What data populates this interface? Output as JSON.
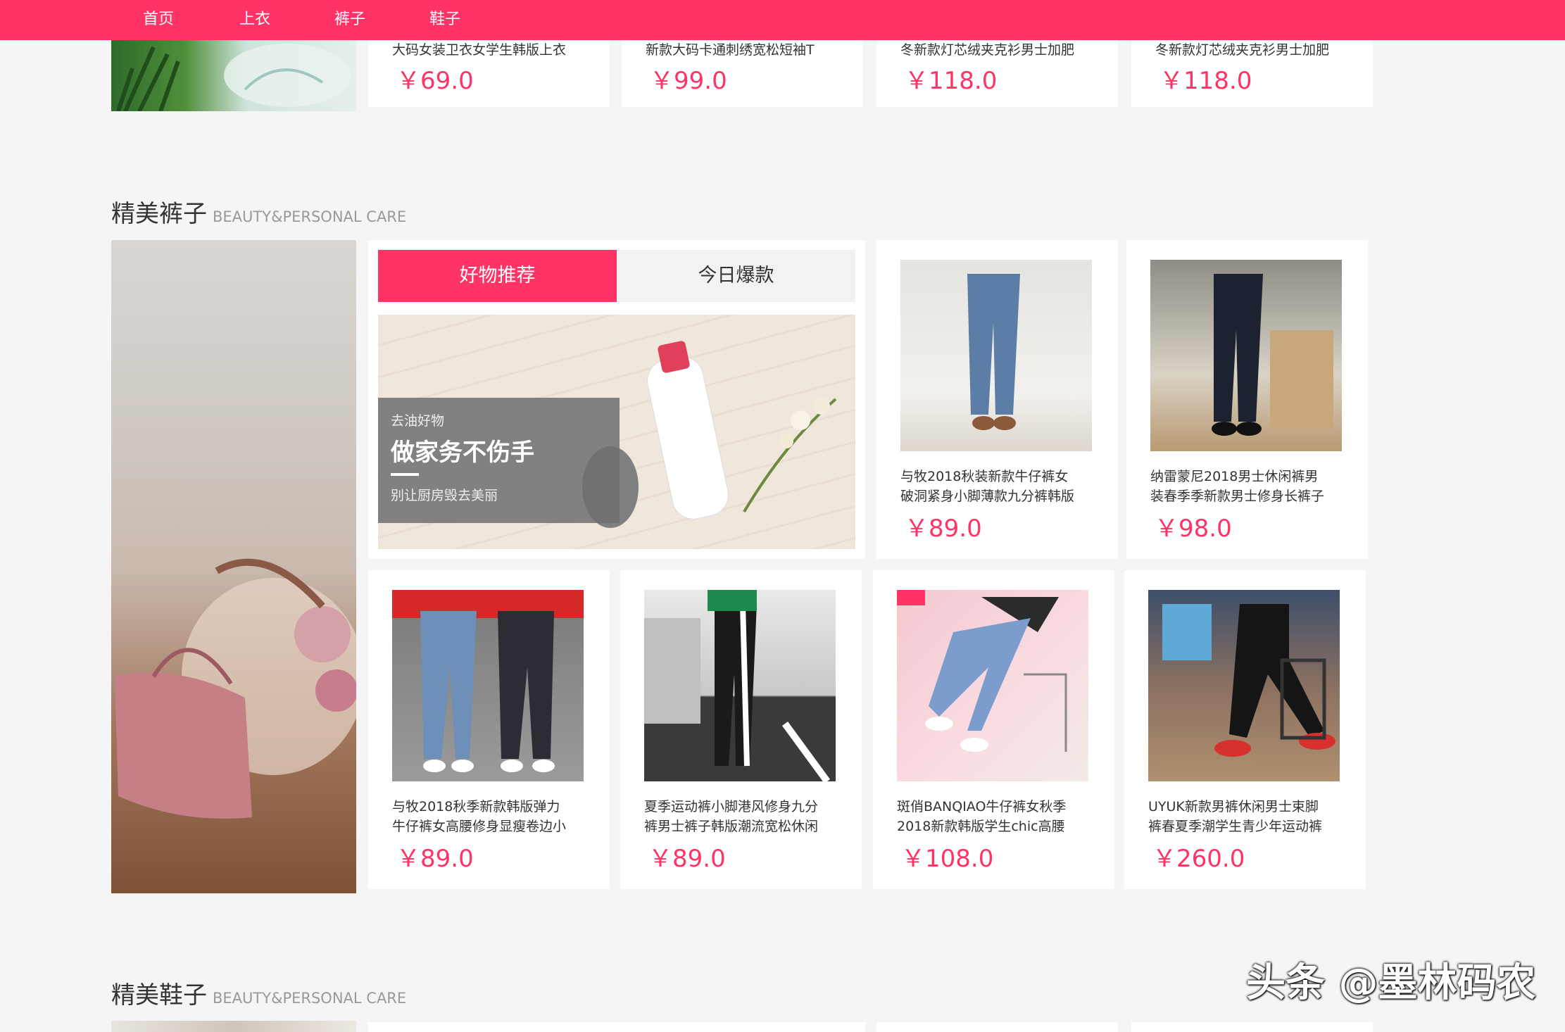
{
  "nav": {
    "items": [
      "首页",
      "上衣",
      "裤子",
      "鞋子"
    ]
  },
  "top_row": {
    "products": [
      {
        "title": "大码女装卫衣女学生韩版上衣",
        "price": "￥69.0"
      },
      {
        "title": "新款大码卡通刺绣宽松短袖T",
        "price": "￥99.0"
      },
      {
        "title": "冬新款灯芯绒夹克衫男士加肥",
        "price": "￥118.0"
      },
      {
        "title": "冬新款灯芯绒夹克衫男士加肥",
        "price": "￥118.0"
      }
    ]
  },
  "section_pants": {
    "title": "精美裤子",
    "subtitle": "BEAUTY&PERSONAL CARE",
    "tabs": [
      "好物推荐",
      "今日爆款"
    ],
    "banner": {
      "kicker": "去油好物",
      "headline": "做家务不伤手",
      "tagline": "别让厨房毁去美丽"
    },
    "products": [
      {
        "title_line1": "与牧2018秋装新款牛仔裤女",
        "title_line2": "破洞紧身小脚薄款九分裤韩版",
        "price": "￥89.0"
      },
      {
        "title_line1": "纳雷蒙尼2018男士休闲裤男",
        "title_line2": "装春季季新款男士修身长裤子",
        "price": "￥98.0"
      },
      {
        "title_line1": "与牧2018秋季新款韩版弹力",
        "title_line2": "牛仔裤女高腰修身显瘦卷边小",
        "price": "￥89.0"
      },
      {
        "title_line1": "夏季运动裤小脚港风修身九分",
        "title_line2": "裤男士裤子韩版潮流宽松休闲",
        "price": "￥89.0"
      },
      {
        "title_line1": "斑俏BANQIAO牛仔裤女秋季",
        "title_line2": "2018新款韩版学生chic高腰",
        "price": "￥108.0"
      },
      {
        "title_line1": "UYUK新款男裤休闲男士束脚",
        "title_line2": "裤春夏季潮学生青少年运动裤",
        "price": "￥260.0"
      }
    ]
  },
  "section_shoes": {
    "title": "精美鞋子",
    "subtitle": "BEAUTY&PERSONAL CARE"
  },
  "watermark": "头条 @墨林码农",
  "colors": {
    "accent": "#ff3366",
    "background": "#f5f5f5"
  }
}
